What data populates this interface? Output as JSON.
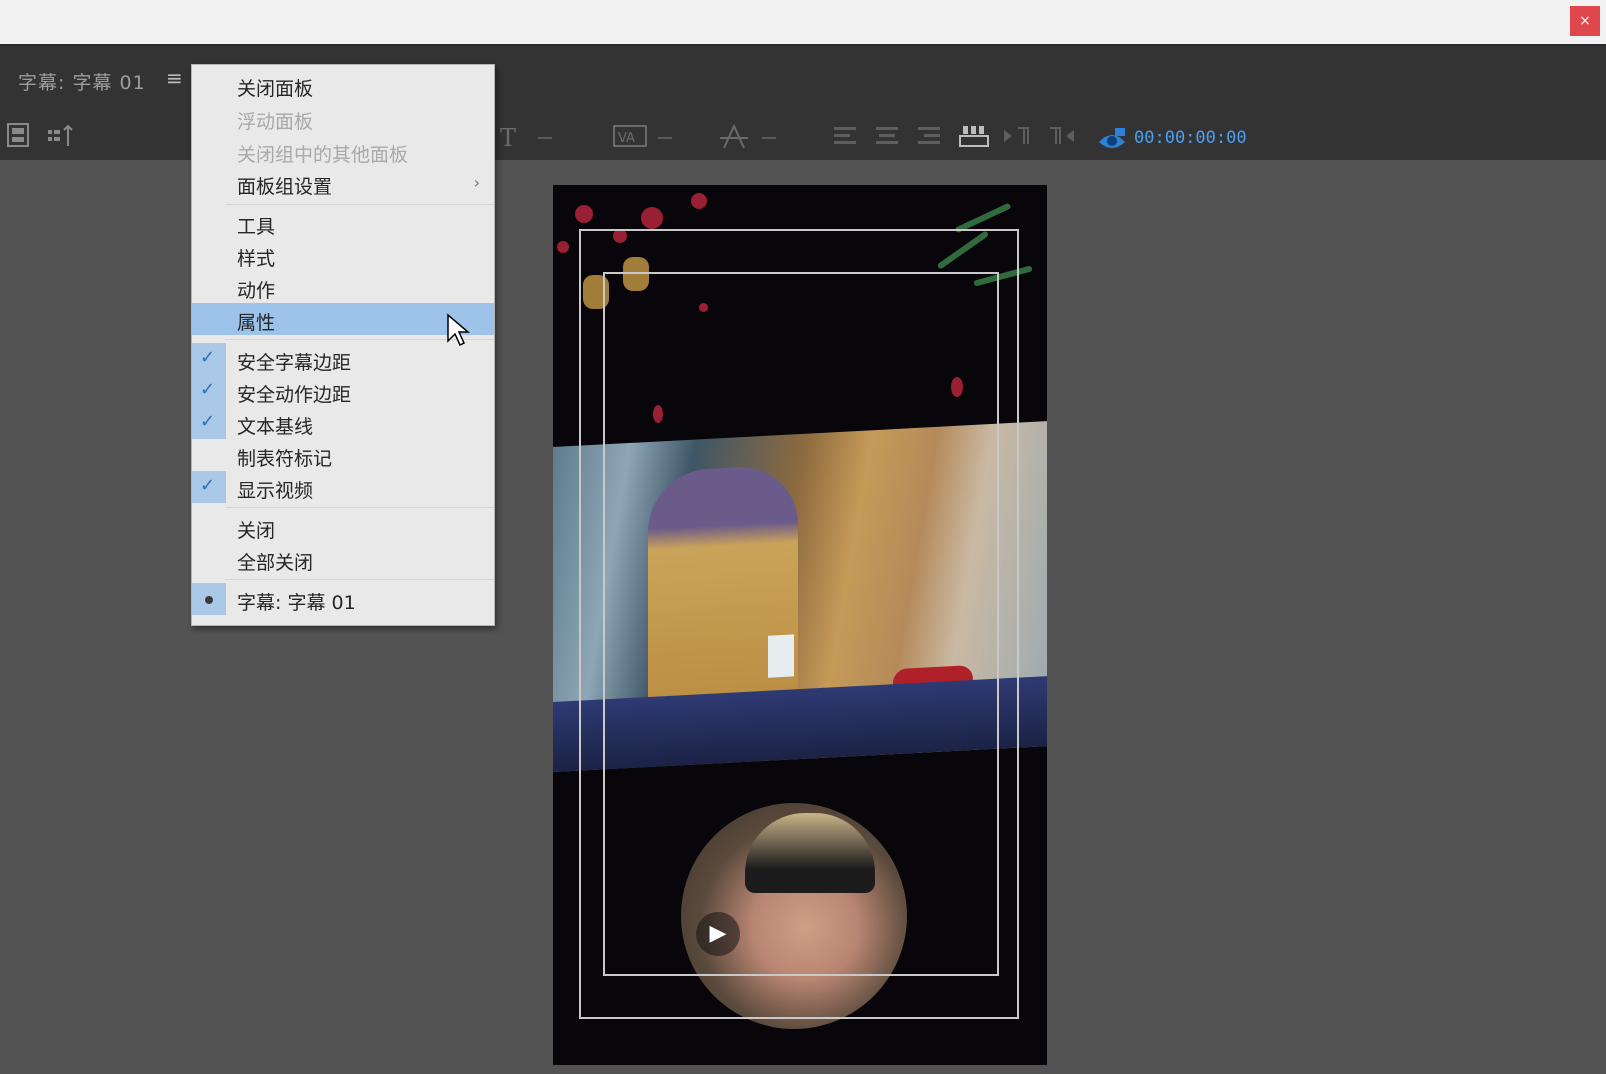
{
  "window": {
    "close_glyph": "×"
  },
  "panel": {
    "tab_label": "字幕: 字幕 01",
    "menu_icon": "≡"
  },
  "toolbar": {
    "timecode": "00:00:00:00"
  },
  "context_menu": {
    "items": [
      {
        "label": "关闭面板",
        "enabled": true
      },
      {
        "label": "浮动面板",
        "enabled": false
      },
      {
        "label": "关闭组中的其他面板",
        "enabled": false
      },
      {
        "label": "面板组设置",
        "enabled": true,
        "submenu": true
      },
      {
        "label": "工具",
        "enabled": true
      },
      {
        "label": "样式",
        "enabled": true
      },
      {
        "label": "动作",
        "enabled": true
      },
      {
        "label": "属性",
        "enabled": true,
        "highlighted": true
      },
      {
        "label": "安全字幕边距",
        "enabled": true,
        "checked": true
      },
      {
        "label": "安全动作边距",
        "enabled": true,
        "checked": true
      },
      {
        "label": "文本基线",
        "enabled": true,
        "checked": true
      },
      {
        "label": "制表符标记",
        "enabled": true,
        "checked": false
      },
      {
        "label": "显示视频",
        "enabled": true,
        "checked": true
      },
      {
        "label": "关闭",
        "enabled": true
      },
      {
        "label": "全部关闭",
        "enabled": true
      },
      {
        "label": "字幕: 字幕 01",
        "enabled": true,
        "active": true
      }
    ],
    "submenu_arrow": "›",
    "check_glyph": "✓"
  },
  "preview": {
    "play_glyph": "▶"
  }
}
